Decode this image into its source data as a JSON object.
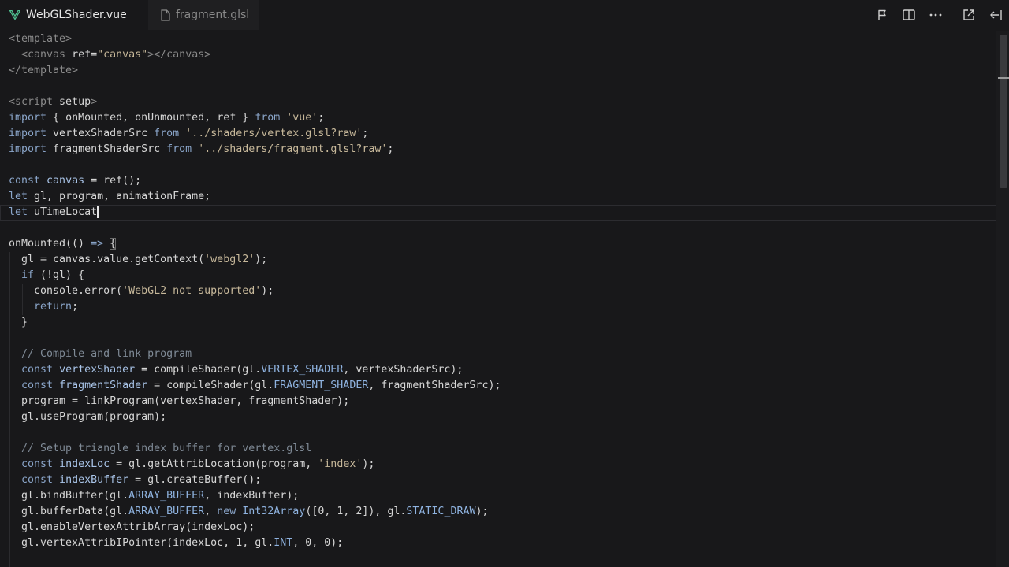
{
  "tabs": [
    {
      "label": "WebGLShader.vue",
      "active": true,
      "dirty": true,
      "icon": "vue-icon"
    },
    {
      "label": "fragment.glsl",
      "active": false,
      "dirty": false,
      "icon": "file-icon"
    }
  ],
  "toolbar": {
    "icons": [
      "format-icon",
      "split-editor-icon",
      "more-icon",
      "open-external-icon",
      "collapse-panel-icon"
    ]
  },
  "colors": {
    "background": "#18181a",
    "keyword": "#8aa5c9",
    "string": "#c7b89a",
    "comment": "#7f8a96",
    "constant": "#8fb3e0",
    "tag": "#8a8a8a"
  },
  "code": {
    "lines": [
      [
        [
          "tag",
          "<template>"
        ]
      ],
      [
        [
          "plain",
          "  "
        ],
        [
          "tag",
          "<canvas "
        ],
        [
          "attr",
          "ref"
        ],
        [
          "plain",
          "="
        ],
        [
          "str",
          "\"canvas\""
        ],
        [
          "tag",
          "></canvas>"
        ]
      ],
      [
        [
          "tag",
          "</template>"
        ]
      ],
      [],
      [
        [
          "tag",
          "<script "
        ],
        [
          "attr",
          "setup"
        ],
        [
          "tag",
          ">"
        ]
      ],
      [
        [
          "kw",
          "import"
        ],
        [
          "plain",
          " { onMounted, onUnmounted, ref } "
        ],
        [
          "kw",
          "from"
        ],
        [
          "plain",
          " "
        ],
        [
          "str",
          "'vue'"
        ],
        [
          "plain",
          ";"
        ]
      ],
      [
        [
          "kw",
          "import"
        ],
        [
          "plain",
          " vertexShaderSrc "
        ],
        [
          "kw",
          "from"
        ],
        [
          "plain",
          " "
        ],
        [
          "str",
          "'../shaders/vertex.glsl?raw'"
        ],
        [
          "plain",
          ";"
        ]
      ],
      [
        [
          "kw",
          "import"
        ],
        [
          "plain",
          " fragmentShaderSrc "
        ],
        [
          "kw",
          "from"
        ],
        [
          "plain",
          " "
        ],
        [
          "str",
          "'../shaders/fragment.glsl?raw'"
        ],
        [
          "plain",
          ";"
        ]
      ],
      [],
      [
        [
          "kw",
          "const"
        ],
        [
          "plain",
          " "
        ],
        [
          "var",
          "canvas"
        ],
        [
          "plain",
          " = ref();"
        ]
      ],
      [
        [
          "kw",
          "let"
        ],
        [
          "plain",
          " gl, program, animationFrame;"
        ]
      ],
      [
        [
          "kw",
          "let"
        ],
        [
          "plain",
          " uTimeLocat"
        ]
      ],
      [],
      [
        [
          "plain",
          "onMounted(() "
        ],
        [
          "kw",
          "=>"
        ],
        [
          "plain",
          " "
        ],
        [
          "plain",
          "{"
        ]
      ],
      [
        [
          "plain",
          "  gl = canvas.value.getContext("
        ],
        [
          "str",
          "'webgl2'"
        ],
        [
          "plain",
          ");"
        ]
      ],
      [
        [
          "plain",
          "  "
        ],
        [
          "kw",
          "if"
        ],
        [
          "plain",
          " (!gl) {"
        ]
      ],
      [
        [
          "plain",
          "    console.error("
        ],
        [
          "str",
          "'WebGL2 not supported'"
        ],
        [
          "plain",
          ");"
        ]
      ],
      [
        [
          "plain",
          "    "
        ],
        [
          "kw",
          "return"
        ],
        [
          "plain",
          ";"
        ]
      ],
      [
        [
          "plain",
          "  }"
        ]
      ],
      [],
      [
        [
          "plain",
          "  "
        ],
        [
          "cmt",
          "// Compile and link program"
        ]
      ],
      [
        [
          "plain",
          "  "
        ],
        [
          "kw",
          "const"
        ],
        [
          "plain",
          " "
        ],
        [
          "var",
          "vertexShader"
        ],
        [
          "plain",
          " = compileShader(gl."
        ],
        [
          "cst",
          "VERTEX_SHADER"
        ],
        [
          "plain",
          ", vertexShaderSrc);"
        ]
      ],
      [
        [
          "plain",
          "  "
        ],
        [
          "kw",
          "const"
        ],
        [
          "plain",
          " "
        ],
        [
          "var",
          "fragmentShader"
        ],
        [
          "plain",
          " = compileShader(gl."
        ],
        [
          "cst",
          "FRAGMENT_SHADER"
        ],
        [
          "plain",
          ", fragmentShaderSrc);"
        ]
      ],
      [
        [
          "plain",
          "  program = linkProgram(vertexShader, fragmentShader);"
        ]
      ],
      [
        [
          "plain",
          "  gl.useProgram(program);"
        ]
      ],
      [],
      [
        [
          "plain",
          "  "
        ],
        [
          "cmt",
          "// Setup triangle index buffer for vertex.glsl"
        ]
      ],
      [
        [
          "plain",
          "  "
        ],
        [
          "kw",
          "const"
        ],
        [
          "plain",
          " "
        ],
        [
          "var",
          "indexLoc"
        ],
        [
          "plain",
          " = gl.getAttribLocation(program, "
        ],
        [
          "str",
          "'index'"
        ],
        [
          "plain",
          ");"
        ]
      ],
      [
        [
          "plain",
          "  "
        ],
        [
          "kw",
          "const"
        ],
        [
          "plain",
          " "
        ],
        [
          "var",
          "indexBuffer"
        ],
        [
          "plain",
          " = gl.createBuffer();"
        ]
      ],
      [
        [
          "plain",
          "  gl.bindBuffer(gl."
        ],
        [
          "cst",
          "ARRAY_BUFFER"
        ],
        [
          "plain",
          ", indexBuffer);"
        ]
      ],
      [
        [
          "plain",
          "  gl.bufferData(gl."
        ],
        [
          "cst",
          "ARRAY_BUFFER"
        ],
        [
          "plain",
          ", "
        ],
        [
          "kw",
          "new"
        ],
        [
          "plain",
          " "
        ],
        [
          "cst",
          "Int32Array"
        ],
        [
          "plain",
          "([0, 1, 2]), gl."
        ],
        [
          "cst",
          "STATIC_DRAW"
        ],
        [
          "plain",
          ");"
        ]
      ],
      [
        [
          "plain",
          "  gl.enableVertexAttribArray(indexLoc);"
        ]
      ],
      [
        [
          "plain",
          "  gl.vertexAttribIPointer(indexLoc, 1, gl."
        ],
        [
          "cst",
          "INT"
        ],
        [
          "plain",
          ", 0, 0);"
        ]
      ],
      []
    ]
  }
}
